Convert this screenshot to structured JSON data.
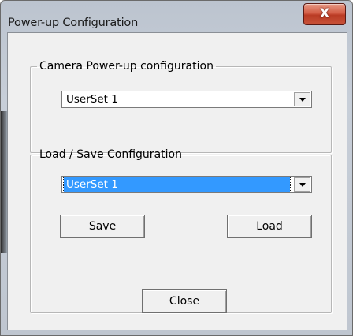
{
  "window": {
    "title": "Power-up Configuration",
    "close_glyph": "X"
  },
  "power_up_group": {
    "label": "Camera Power-up configuration",
    "select": {
      "selected": "UserSet 1"
    }
  },
  "load_save_group": {
    "label": "Load / Save Configuration",
    "select": {
      "selected": "UserSet 1"
    },
    "save_label": "Save",
    "load_label": "Load"
  },
  "footer": {
    "close_label": "Close"
  },
  "colors": {
    "selection_highlight": "#3399ff",
    "close_button": "#c8533a",
    "dialog_background": "#f0f0f0"
  },
  "icons": [
    "close-icon",
    "chevron-down-icon"
  ]
}
